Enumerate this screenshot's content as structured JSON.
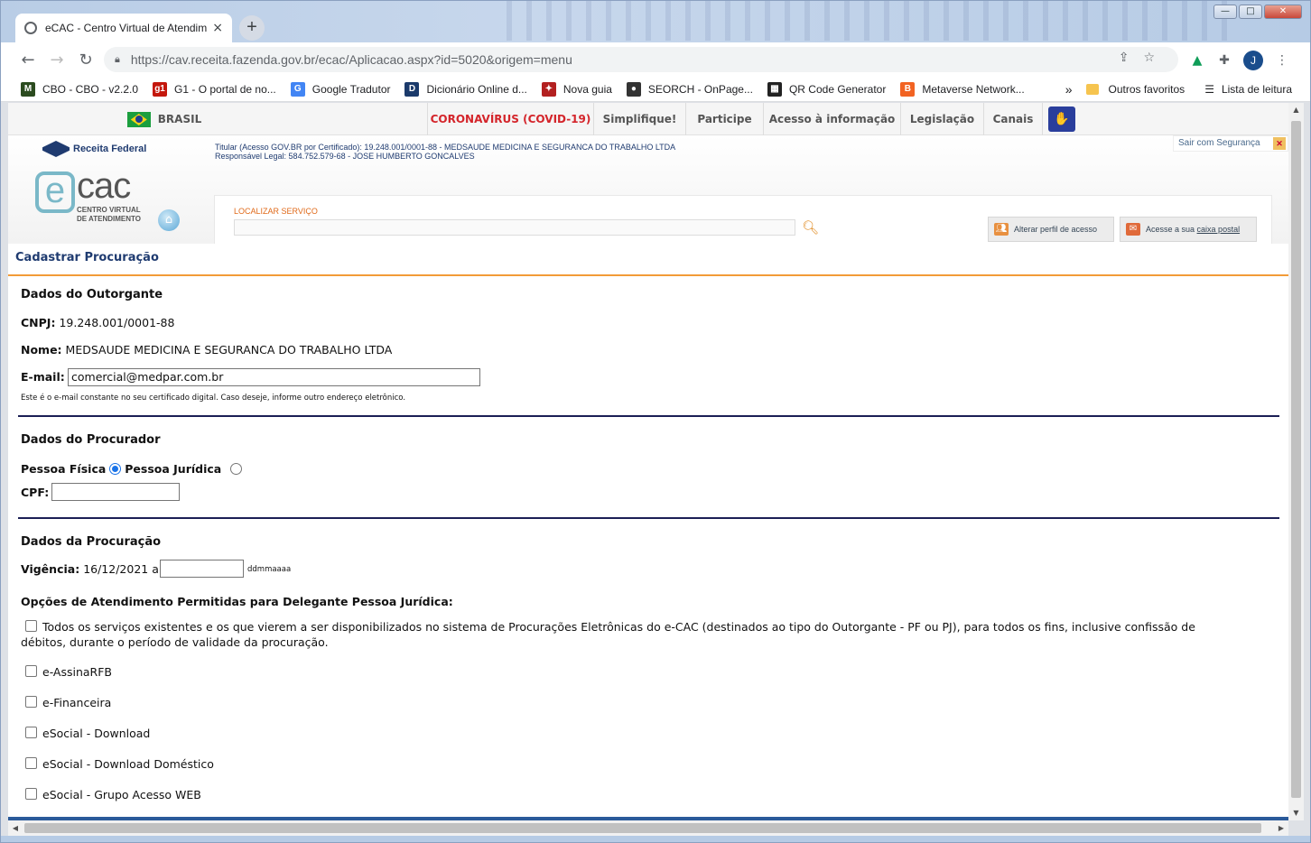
{
  "browser": {
    "tab_title": "eCAC - Centro Virtual de Atendimento",
    "tab_close": "×",
    "new_tab": "+",
    "url": "https://cav.receita.fazenda.gov.br/ecac/Aplicacao.aspx?id=5020&origem=menu",
    "avatar_letter": "J",
    "window_buttons": {
      "minimize": "—",
      "maximize": "□",
      "close": "✕"
    }
  },
  "bookmarks": {
    "items": [
      {
        "label": "CBO - CBO - v2.2.0",
        "icon": "mte-icon",
        "color": "#2b4b1f"
      },
      {
        "label": "G1 - O portal de no...",
        "icon": "g1-icon",
        "color": "#c4170c"
      },
      {
        "label": "Google Tradutor",
        "icon": "translate-icon",
        "color": "#4285f4"
      },
      {
        "label": "Dicionário Online d...",
        "icon": "dictionary-icon",
        "color": "#1b3a6b"
      },
      {
        "label": "Nova guia",
        "icon": "bat-icon",
        "color": "#b32020"
      },
      {
        "label": "SEORCH - OnPage...",
        "icon": "seorch-icon",
        "color": "#333333"
      },
      {
        "label": "QR Code Generator",
        "icon": "qr-icon",
        "color": "#222222"
      },
      {
        "label": "Metaverse Network...",
        "icon": "blogger-icon",
        "color": "#f26322"
      }
    ],
    "more": "»",
    "other_favorites": "Outros favoritos",
    "reading_list": "Lista de leitura"
  },
  "gov_bar": {
    "brasil": "BRASIL",
    "items": [
      "CORONAVÍRUS (COVID-19)",
      "Simplifique!",
      "Participe",
      "Acesso à informação",
      "Legislação",
      "Canais"
    ],
    "covid_color": "#d4252b"
  },
  "ecac_header": {
    "rfb_logo": "Receita Federal",
    "logo_e": "e",
    "logo_cac": "cac",
    "logo_sub1": "CENTRO VIRTUAL",
    "logo_sub2": "DE ATENDIMENTO",
    "titular_line": "Titular (Acesso GOV.BR por Certificado): 19.248.001/0001-88 - MEDSAUDE MEDICINA E SEGURANCA DO TRABALHO LTDA",
    "responsavel_line": "Responsável Legal: 584.752.579-68 - JOSE HUMBERTO GONCALVES",
    "logout": "Sair com Segurança",
    "search_label": "LOCALIZAR SERVIÇO",
    "alter_profile": "Alterar perfil de acesso",
    "mailbox_prefix": "Acesse a sua ",
    "mailbox_link": "caixa postal"
  },
  "form": {
    "page_title": "Cadastrar Procuração",
    "outorgante": {
      "heading": "Dados do Outorgante",
      "cnpj_label": "CNPJ:",
      "cnpj_value": "19.248.001/0001-88",
      "nome_label": "Nome:",
      "nome_value": "MEDSAUDE MEDICINA E SEGURANCA DO TRABALHO LTDA",
      "email_label": "E-mail:",
      "email_value": "comercial@medpar.com.br",
      "email_hint": "Este é o e-mail constante no seu certificado digital. Caso deseje, informe outro endereço eletrônico."
    },
    "procurador": {
      "heading": "Dados do Procurador",
      "pf_label": "Pessoa Física",
      "pj_label": "Pessoa Jurídica",
      "selected": "Pessoa Física",
      "cpf_label": "CPF:",
      "cpf_value": ""
    },
    "procuracao": {
      "heading": "Dados da Procuração",
      "vigencia_label": "Vigência:",
      "vigencia_start": "16/12/2021",
      "vigencia_sep": "a",
      "vigencia_end": "",
      "date_format": "ddmmaaaa",
      "options_heading": "Opções de Atendimento Permitidas para Delegante Pessoa Jurídica:",
      "all_services_line1": "Todos os serviços existentes e os que vierem a ser disponibilizados no sistema de Procurações Eletrônicas do e-CAC (destinados ao tipo do Outorgante - PF ou PJ), para todos os fins, inclusive confissão de",
      "all_services_line2": "débitos, durante o período de validade da procuração.",
      "options": [
        "e-AssinaRFB",
        "e-Financeira",
        "eSocial - Download",
        "eSocial - Download Doméstico",
        "eSocial - Grupo Acesso WEB"
      ]
    }
  }
}
